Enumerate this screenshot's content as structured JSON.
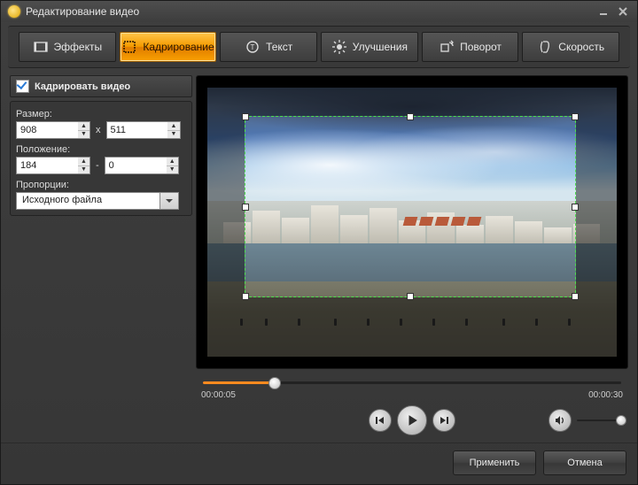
{
  "window": {
    "title": "Редактирование видео"
  },
  "tabs": {
    "effects": "Эффекты",
    "crop": "Кадрирование",
    "text": "Текст",
    "enhance": "Улучшения",
    "rotate": "Поворот",
    "speed": "Скорость"
  },
  "crop": {
    "checkbox_label": "Кадрировать видео",
    "checked": true,
    "size_label": "Размер:",
    "size_w": "908",
    "size_h": "511",
    "size_sep": "x",
    "pos_label": "Положение:",
    "pos_x": "184",
    "pos_y": "0",
    "pos_sep": "-",
    "aspect_label": "Пропорции:",
    "aspect_value": "Исходного файла"
  },
  "player": {
    "time_current": "00:00:05",
    "time_total": "00:00:30",
    "progress_pct": 17,
    "volume_pct": 100
  },
  "footer": {
    "apply": "Применить",
    "cancel": "Отмена"
  }
}
